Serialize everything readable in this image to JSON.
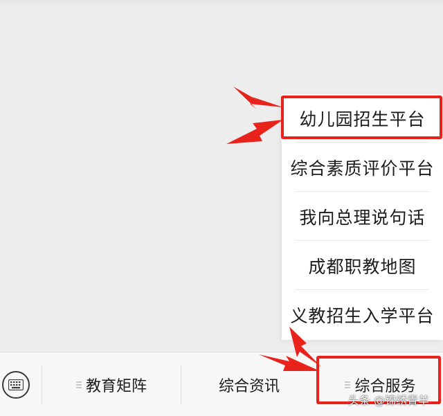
{
  "submenu": {
    "items": [
      {
        "label": "幼儿园招生平台"
      },
      {
        "label": "综合素质评价平台"
      },
      {
        "label": "我向总理说句话"
      },
      {
        "label": "成都职教地图"
      },
      {
        "label": "义教招生入学平台"
      }
    ]
  },
  "menubar": {
    "items": [
      {
        "label": "教育矩阵"
      },
      {
        "label": "综合资讯"
      },
      {
        "label": "综合服务"
      }
    ]
  },
  "watermark": "头条 @锦绣青羊",
  "colors": {
    "annotation_red": "#e8231c",
    "menubar_bg": "#f7f7f7",
    "chat_bg": "#ededed"
  },
  "icons": {
    "keyboard": "keyboard-icon",
    "submenu_marker": "menu-marker-icon",
    "annotation": "arrow-icon"
  }
}
